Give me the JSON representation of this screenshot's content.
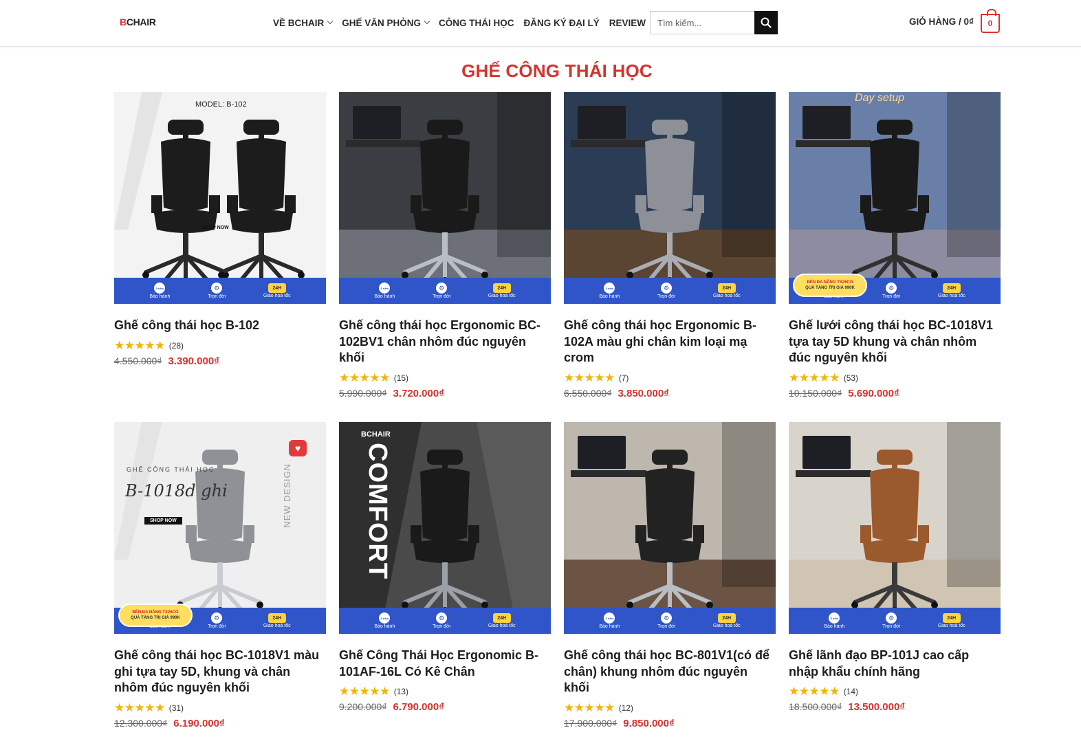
{
  "header": {
    "logo": "BCHAIR",
    "nav": [
      {
        "label": "VỀ BCHAIR",
        "has_dropdown": true
      },
      {
        "label": "GHẾ VĂN PHÒNG",
        "has_dropdown": true
      },
      {
        "label": "CÔNG THÁI HỌC",
        "has_dropdown": false
      },
      {
        "label": "ĐĂNG KÝ ĐẠI LÝ",
        "has_dropdown": false
      },
      {
        "label": "REVIEW",
        "has_dropdown": false
      }
    ],
    "search": {
      "placeholder": "Tìm kiếm...",
      "value": ""
    },
    "cart": {
      "label": "GIỎ HÀNG / 0₫",
      "count": "0"
    }
  },
  "section_title": "GHẾ CÔNG THÁI HỌC",
  "banner": {
    "warranty": "Bảo hành",
    "lifetime": "Trọn đời",
    "delivery": "Giao hoả tốc",
    "express": "24H",
    "warranty_icon": "5 năm"
  },
  "promo": {
    "line1": "ĐÈN ĐA NĂNG TX26CO",
    "line2": "QUÀ TẶNG TRỊ GIÁ 990K"
  },
  "thumb_text": {
    "p1_model": "MODEL: B-102",
    "p1_shop": "SHOP NOW",
    "p5_heading": "GHẾ CÔNG THÁI HỌC",
    "p5_script": "B-1018d ghi",
    "p5_shop": "SHOP NOW",
    "p5_side": "NEW DESIGN",
    "p6_logo": "BCHAIR",
    "p6_word": "COMFORT",
    "p4_sign": "Day setup"
  },
  "products": [
    {
      "title": "Ghế công thái học B-102",
      "stars": 5,
      "reviews": "(28)",
      "old_price": "4.550.000₫",
      "price": "3.390.000₫",
      "scene": "studio-light",
      "promo": false
    },
    {
      "title": "Ghế công thái học Ergonomic BC-102BV1 chân nhôm đúc nguyên khối",
      "stars": 5,
      "reviews": "(15)",
      "old_price": "5.990.000₫",
      "price": "3.720.000₫",
      "scene": "room-dark",
      "promo": false
    },
    {
      "title": "Ghế công thái học Ergonomic B-102A màu ghi chân kim loại mạ crom",
      "stars": 5,
      "reviews": "(7)",
      "old_price": "6.550.000₫",
      "price": "3.850.000₫",
      "scene": "room-blue",
      "promo": false
    },
    {
      "title": "Ghế lưới công thái học BC-1018V1 tựa tay 5D khung và chân nhôm đúc nguyên khối",
      "stars": 5,
      "reviews": "(53)",
      "old_price": "10.150.000₫",
      "price": "5.690.000₫",
      "scene": "room-neon",
      "promo": true
    },
    {
      "title": "Ghế công thái học BC-1018V1 màu ghi tựa tay 5D, khung và chân nhôm đúc nguyên khối",
      "stars": 5,
      "reviews": "(31)",
      "old_price": "12.300.000₫",
      "price": "6.190.000₫",
      "scene": "studio-grey",
      "promo": true
    },
    {
      "title": "Ghế Công Thái Học Ergonomic B-101AF-16L Có Kê Chân",
      "stars": 5,
      "reviews": "(13)",
      "old_price": "9.200.000₫",
      "price": "6.790.000₫",
      "scene": "comfort-dark",
      "promo": false
    },
    {
      "title": "Ghế công thái học BC-801V1(có để chân) khung nhôm đúc nguyên khối",
      "stars": 5,
      "reviews": "(12)",
      "old_price": "17.900.000₫",
      "price": "9.850.000₫",
      "scene": "room-wood",
      "promo": false
    },
    {
      "title": "Ghế lãnh đạo BP-101J cao cấp nhập khẩu chính hãng",
      "stars": 5,
      "reviews": "(14)",
      "old_price": "18.500.000₫",
      "price": "13.500.000₫",
      "scene": "room-leather",
      "promo": false
    }
  ],
  "colors": {
    "accent": "#d6332f",
    "banner": "#2f55c9",
    "star": "#f5b301"
  }
}
